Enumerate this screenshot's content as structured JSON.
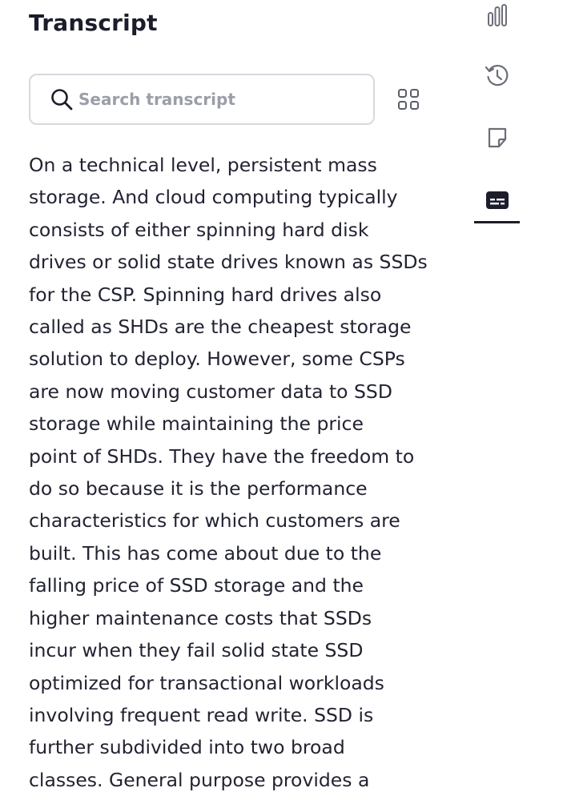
{
  "panel": {
    "title": "Transcript"
  },
  "search": {
    "placeholder": "Search transcript",
    "value": ""
  },
  "transcript": {
    "text": "On a technical level, persistent mass\nstorage. And cloud computing typically\nconsists of either spinning hard disk\ndrives or solid state drives known as SSDs\nfor the CSP. Spinning hard drives also\ncalled as SHDs are the cheapest storage\nsolution to deploy. However, some CSPs\nare now moving customer data to SSD\nstorage while maintaining the price\npoint of SHDs. They have the freedom to\ndo so because it is the performance\ncharacteristics for which customers are\nbuilt. This has come about due to the\nfalling price of SSD storage and the\nhigher maintenance costs that SSDs\nincur when they fail solid state SSD\noptimized for transactional workloads\ninvolving frequent read write. SSD is\nfurther subdivided into two broad\nclasses. General purpose provides a"
  },
  "side_rail": {
    "items": [
      {
        "icon": "bar-chart-icon",
        "active": false
      },
      {
        "icon": "history-icon",
        "active": false
      },
      {
        "icon": "note-icon",
        "active": false
      },
      {
        "icon": "captions-icon",
        "active": true
      }
    ]
  },
  "colors": {
    "text": "#222332",
    "heading": "#1c1d2b",
    "border": "#d7d9df",
    "placeholder": "#9b9ea8",
    "icon": "#6b6e78"
  }
}
